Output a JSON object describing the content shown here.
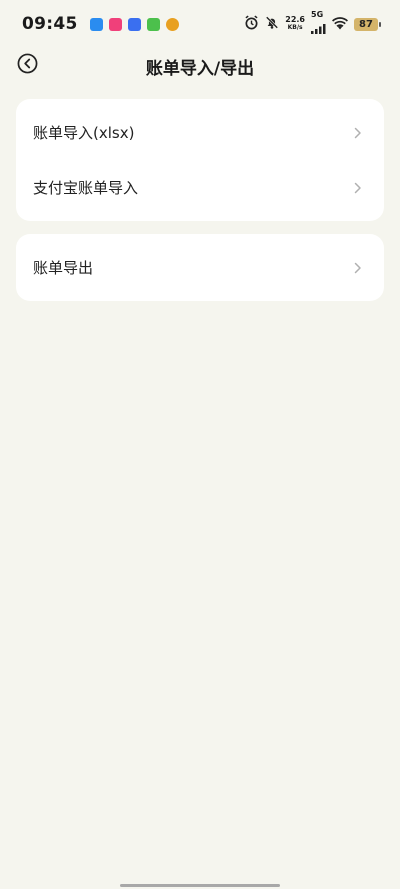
{
  "status_bar": {
    "time": "09:45",
    "speed_value": "22.6",
    "speed_unit": "KB/s",
    "network": "5G",
    "battery": "87",
    "app_icons": [
      {
        "name": "app-icon-1",
        "color": "#2a8cf0"
      },
      {
        "name": "app-icon-2",
        "color": "#f0407a"
      },
      {
        "name": "app-icon-3",
        "color": "#3a6ff0"
      },
      {
        "name": "app-icon-4",
        "color": "#4cc04c"
      },
      {
        "name": "app-icon-5",
        "color": "#e8a020"
      }
    ]
  },
  "header": {
    "title": "账单导入/导出",
    "back_icon": "back-circle-icon"
  },
  "groups": [
    {
      "items": [
        {
          "label": "账单导入(xlsx)",
          "icon": "chevron-right-icon"
        },
        {
          "label": "支付宝账单导入",
          "icon": "chevron-right-icon"
        }
      ]
    },
    {
      "items": [
        {
          "label": "账单导出",
          "icon": "chevron-right-icon"
        }
      ]
    }
  ],
  "colors": {
    "background": "#f5f5ee",
    "card": "#ffffff",
    "text": "#222222",
    "chevron": "#b0b0b0"
  }
}
